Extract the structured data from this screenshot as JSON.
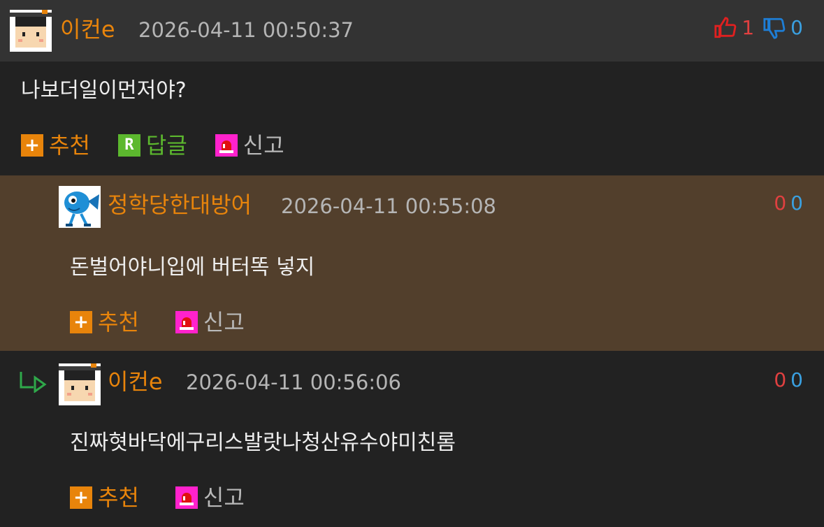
{
  "colors": {
    "header_bg": "#333333",
    "body_bg": "#222222",
    "reply_highlight_bg": "#523f2c",
    "nick_orange": "#e8840b",
    "up_red": "#e04040",
    "down_blue": "#3aa0e0",
    "reply_green": "#5cb82e",
    "report_magenta": "#ff22cc"
  },
  "comments": [
    {
      "nick": "이컨e",
      "date": "2026-04-11 00:50:37",
      "up": "1",
      "down": "0",
      "text": "나보더일이먼저야?",
      "avatar_icon": "graduate-avatar-icon",
      "actions": {
        "recommend": "추천",
        "reply": "답글",
        "report": "신고"
      }
    },
    {
      "nick": "정학당한대방어",
      "date": "2026-04-11 00:55:08",
      "up": "0",
      "down": "0",
      "text": "돈벌어야니입에 버터똑 넣지",
      "avatar_icon": "blue-fish-avatar-icon",
      "actions": {
        "recommend": "추천",
        "report": "신고"
      }
    },
    {
      "nick": "이컨e",
      "date": "2026-04-11 00:56:06",
      "up": "0",
      "down": "0",
      "text": "진짜혓바닥에구리스발랏나청산유수야미친롬",
      "avatar_icon": "graduate-avatar-icon",
      "actions": {
        "recommend": "추천",
        "report": "신고"
      }
    }
  ]
}
